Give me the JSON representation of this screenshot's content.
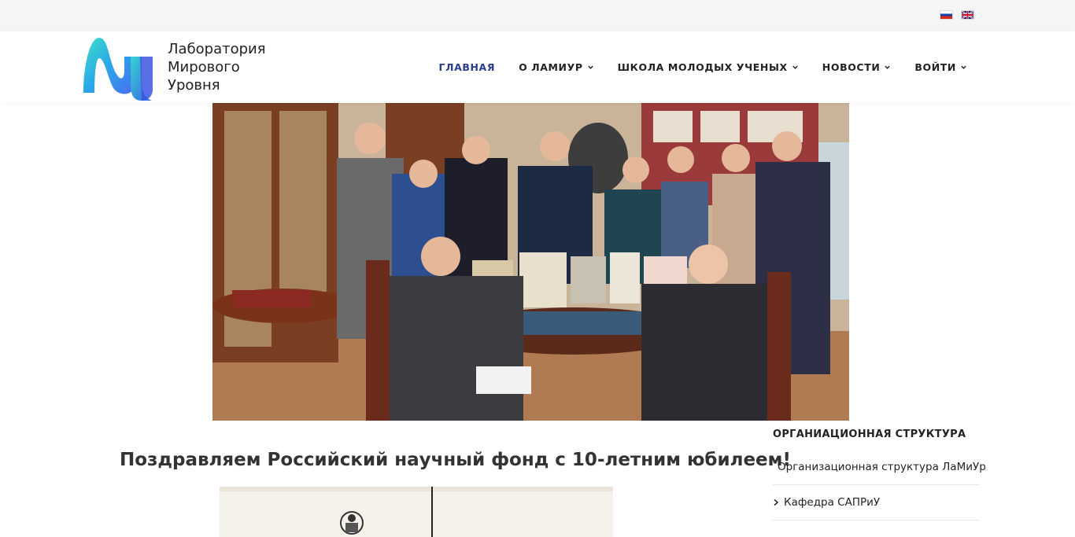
{
  "languages": [
    {
      "code": "ru",
      "icon": "flag-ru-icon"
    },
    {
      "code": "en",
      "icon": "flag-en-icon"
    }
  ],
  "logo": {
    "line1": "Лаборатория",
    "line2": "Мирового",
    "line3": "Уровня"
  },
  "nav": {
    "home": "ГЛАВНАЯ",
    "about": "О ЛАМИУР",
    "school": "ШКОЛА МОЛОДЫХ УЧЕНЫХ",
    "news": "НОВОСТИ",
    "login": "ВОЙТИ"
  },
  "colors": {
    "accent": "#2b3d8f",
    "topbar": "#f5f5f5",
    "text": "#333333"
  },
  "post": {
    "title": "Поздравляем Российский научный фонд с 10-летним юбилеем!"
  },
  "sidebar": {
    "title": "ОРГАНИАЦИОННАЯ СТРУКТУРА",
    "items": [
      "Организационная структура ЛаМиУр",
      "Кафедра САПРиУ"
    ]
  }
}
